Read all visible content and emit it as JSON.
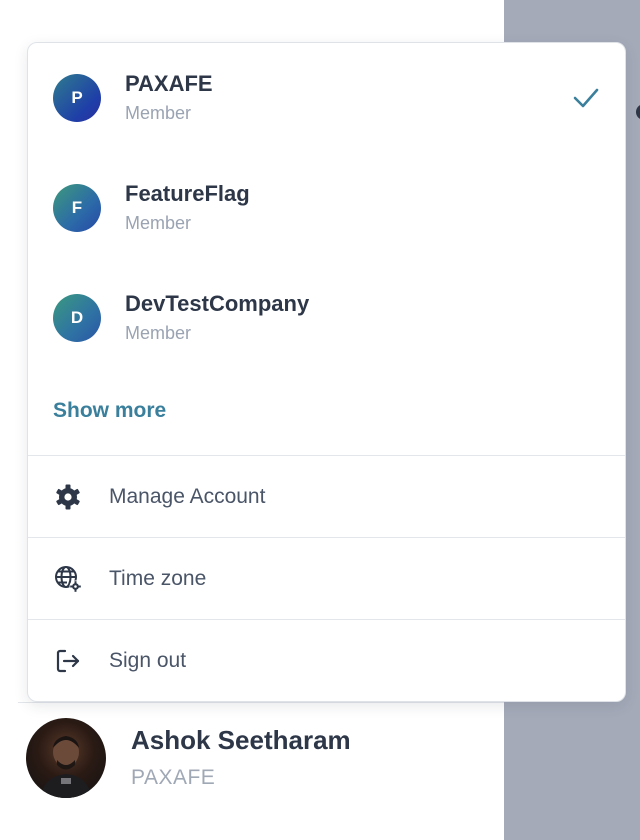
{
  "organizations": [
    {
      "initial": "P",
      "name": "PAXAFE",
      "role": "Member",
      "selected": true
    },
    {
      "initial": "F",
      "name": "FeatureFlag",
      "role": "Member",
      "selected": false
    },
    {
      "initial": "D",
      "name": "DevTestCompany",
      "role": "Member",
      "selected": false
    }
  ],
  "show_more_label": "Show more",
  "menu": {
    "manage_account": {
      "label": "Manage Account",
      "icon": "gear-icon"
    },
    "time_zone": {
      "label": "Time zone",
      "icon": "globe-gear-icon"
    },
    "sign_out": {
      "label": "Sign out",
      "icon": "sign-out-icon"
    }
  },
  "user": {
    "name": "Ashok Seetharam",
    "organization": "PAXAFE"
  },
  "colors": {
    "accent": "#3a7f9c",
    "text_primary": "#2d3748",
    "text_muted": "#9aa3b2",
    "overlay": "#a4aab8"
  }
}
